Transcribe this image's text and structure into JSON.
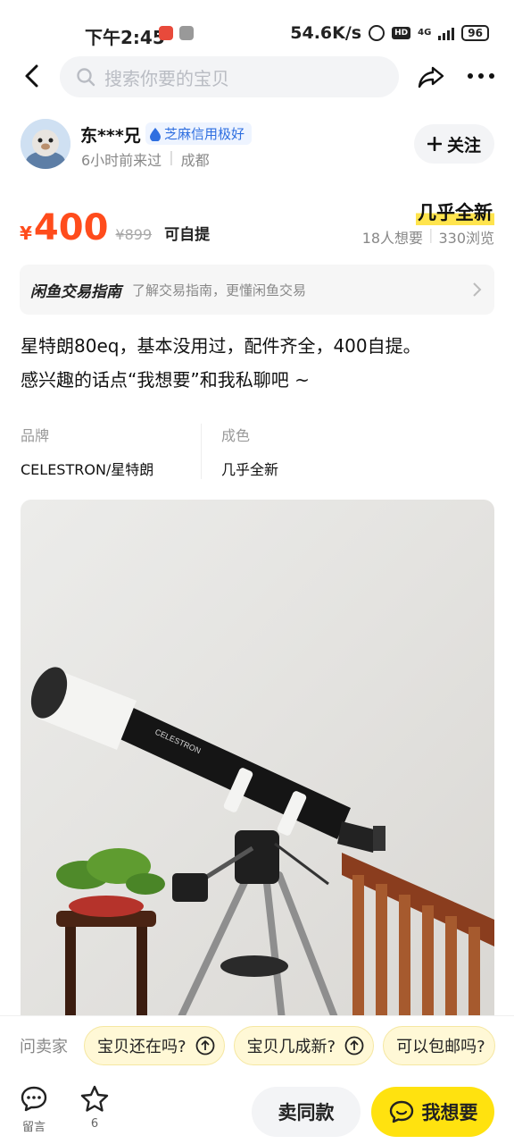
{
  "status_bar": {
    "time": "下午2:45",
    "speed": "54.6K/s",
    "network": "4G",
    "battery": "96"
  },
  "search": {
    "placeholder": "搜索你要的宝贝"
  },
  "seller": {
    "name": "东***兄",
    "credit": "芝麻信用极好",
    "last_seen": "6小时前来过",
    "city": "成都",
    "follow_label": "关注"
  },
  "price": {
    "currency": "¥",
    "value": "400",
    "original": "¥899",
    "delivery": "可自提"
  },
  "condition": "几乎全新",
  "stats": {
    "wants": "18人想要",
    "views": "330浏览"
  },
  "guide": {
    "title": "闲鱼交易指南",
    "desc": "了解交易指南，更懂闲鱼交易"
  },
  "description": {
    "line1": "星特朗80eq，基本没用过，配件齐全，400自提。",
    "line2": "感兴趣的话点“我想要”和我私聊吧 ~"
  },
  "attributes": [
    {
      "label": "品牌",
      "value": "CELESTRON/星特朗"
    },
    {
      "label": "成色",
      "value": "几乎全新"
    }
  ],
  "photo": {
    "brand_text": "CELESTRON"
  },
  "quick_questions": {
    "label": "问卖家",
    "chips": [
      "宝贝还在吗?",
      "宝贝几成新?",
      "可以包邮吗?"
    ]
  },
  "bottom_bar": {
    "comment_label": "留言",
    "fav_count": "6",
    "sell_same_label": "卖同款",
    "want_label": "我想要"
  },
  "colors": {
    "price": "#ff4c1c",
    "want_button": "#ffe20f",
    "credit": "#2f6fe0",
    "highlight": "#ffe44d"
  },
  "icons": [
    "back-icon",
    "search-icon",
    "share-icon",
    "more-icon",
    "drop-icon",
    "plus-icon",
    "chevron-right-icon",
    "arrow-up-circle-icon",
    "comment-icon",
    "star-icon",
    "chat-icon"
  ]
}
